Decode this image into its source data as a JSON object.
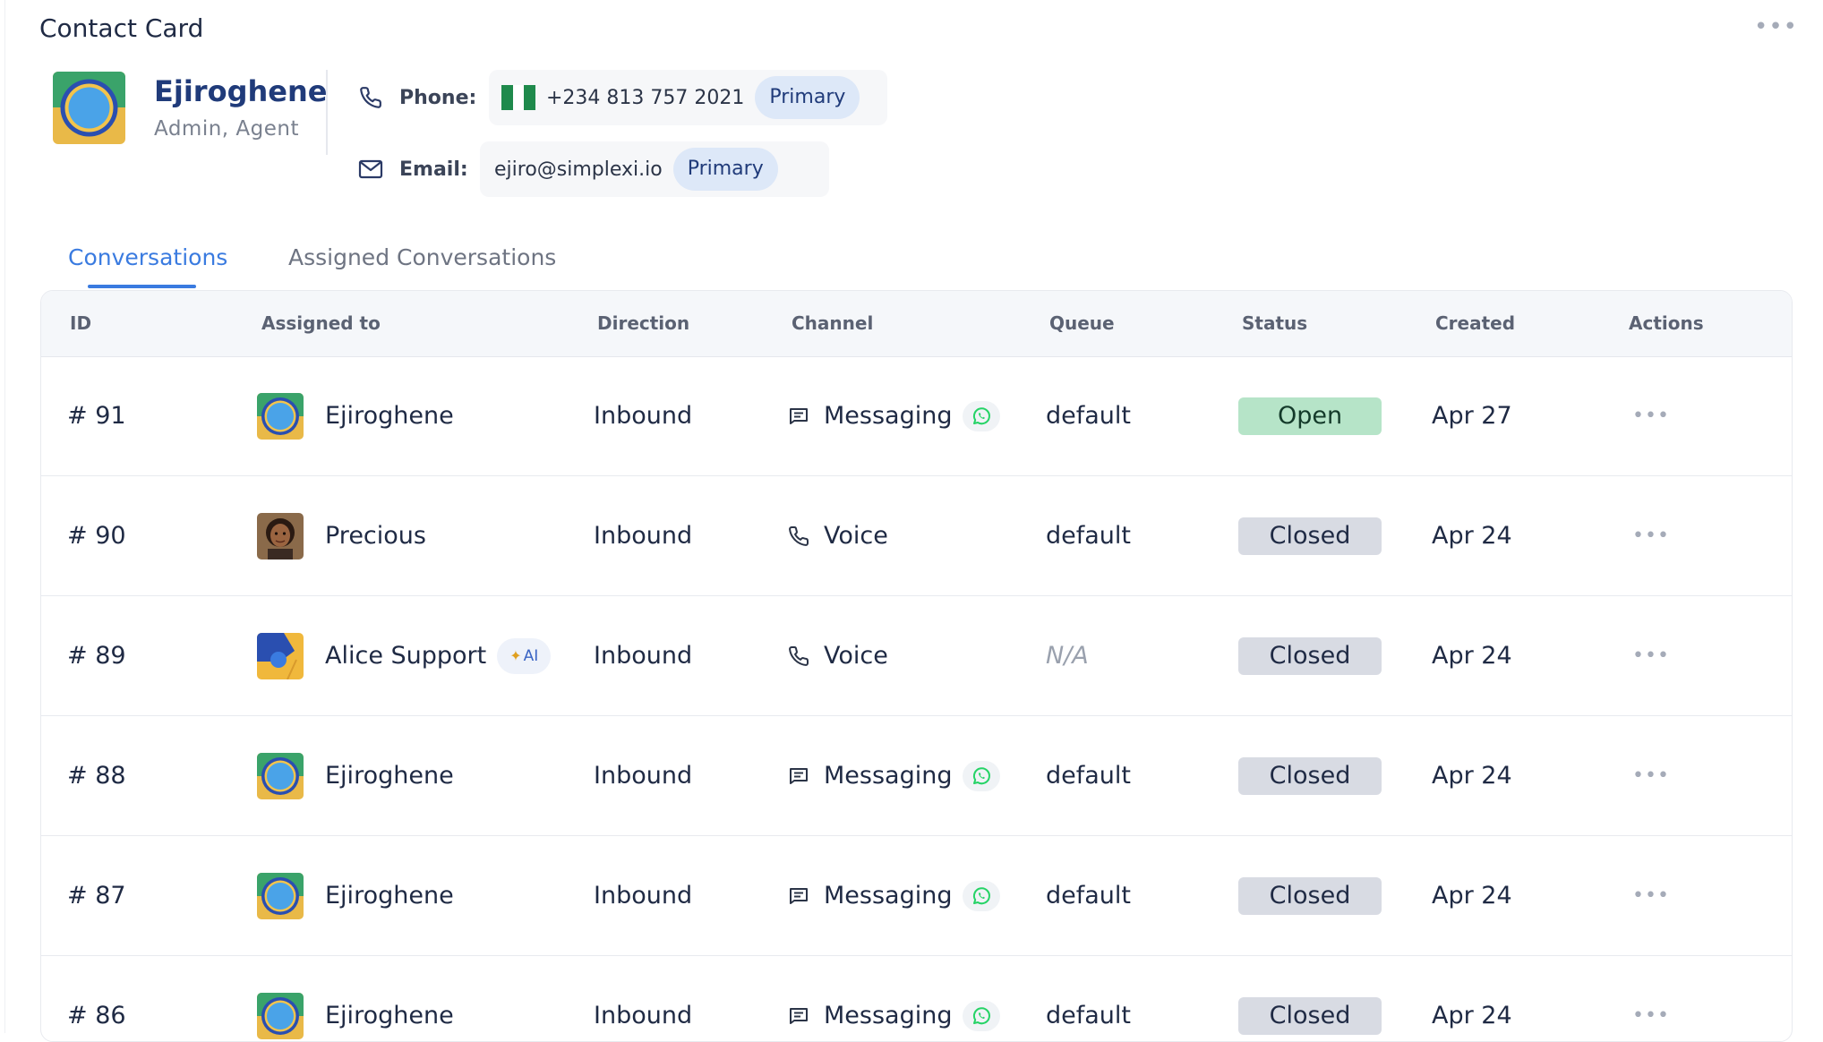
{
  "header": {
    "title": "Contact Card"
  },
  "profile": {
    "name": "Ejiroghene",
    "roles": "Admin, Agent",
    "phone_label": "Phone:",
    "phone_value": "+234 813 757 2021",
    "phone_badge": "Primary",
    "email_label": "Email:",
    "email_value": "ejiro@simplexi.io",
    "email_badge": "Primary"
  },
  "tabs": [
    {
      "label": "Conversations",
      "active": true
    },
    {
      "label": "Assigned Conversations",
      "active": false
    }
  ],
  "table": {
    "columns": [
      "ID",
      "Assigned to",
      "Direction",
      "Channel",
      "Queue",
      "Status",
      "Created",
      "Actions"
    ],
    "rows": [
      {
        "id": "# 91",
        "assignee": "Ejiroghene",
        "avatar": "ring",
        "direction": "Inbound",
        "channel": "Messaging",
        "channel_icon": "message-icon",
        "whatsapp": true,
        "queue": "default",
        "status": "Open",
        "created": "Apr 27"
      },
      {
        "id": "# 90",
        "assignee": "Precious",
        "avatar": "photo",
        "direction": "Inbound",
        "channel": "Voice",
        "channel_icon": "phone-icon",
        "whatsapp": false,
        "queue": "default",
        "status": "Closed",
        "created": "Apr 24"
      },
      {
        "id": "# 89",
        "assignee": "Alice Support",
        "avatar": "ai",
        "ai_badge": "AI",
        "direction": "Inbound",
        "channel": "Voice",
        "channel_icon": "phone-icon",
        "whatsapp": false,
        "queue": "N/A",
        "status": "Closed",
        "created": "Apr 24"
      },
      {
        "id": "# 88",
        "assignee": "Ejiroghene",
        "avatar": "ring",
        "direction": "Inbound",
        "channel": "Messaging",
        "channel_icon": "message-icon",
        "whatsapp": true,
        "queue": "default",
        "status": "Closed",
        "created": "Apr 24"
      },
      {
        "id": "# 87",
        "assignee": "Ejiroghene",
        "avatar": "ring",
        "direction": "Inbound",
        "channel": "Messaging",
        "channel_icon": "message-icon",
        "whatsapp": true,
        "queue": "default",
        "status": "Closed",
        "created": "Apr 24"
      },
      {
        "id": "# 86",
        "assignee": "Ejiroghene",
        "avatar": "ring",
        "direction": "Inbound",
        "channel": "Messaging",
        "channel_icon": "message-icon",
        "whatsapp": true,
        "queue": "default",
        "status": "Closed",
        "created": "Apr 24"
      }
    ]
  },
  "colors": {
    "accent": "#3a7be0",
    "name_text": "#203b7a",
    "status_open_bg": "#b6e4c8",
    "status_closed_bg": "#d8dbe3",
    "primary_badge_bg": "#dde8f8",
    "whatsapp_green": "#25d366",
    "flag_green": "#1f8a4c"
  },
  "icons": {
    "more": "more-horizontal-icon",
    "phone": "phone-icon",
    "email": "mail-icon",
    "message": "message-icon",
    "whatsapp": "whatsapp-icon",
    "flag": "nigeria-flag-icon"
  }
}
